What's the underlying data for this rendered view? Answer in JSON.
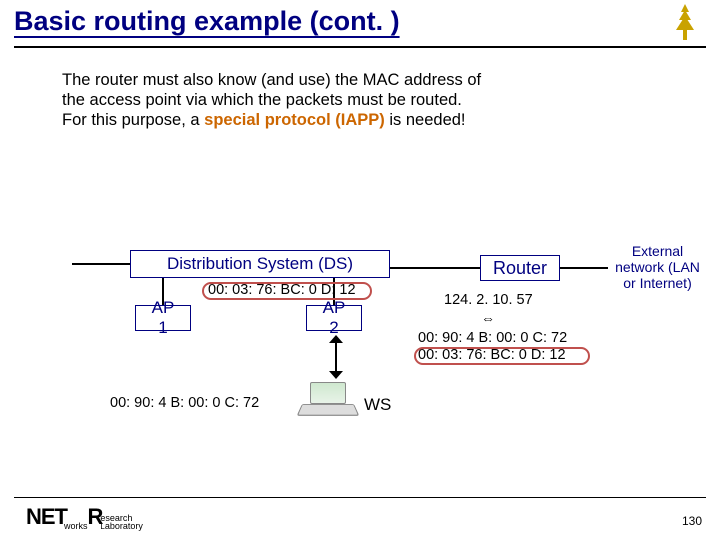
{
  "title": "Basic routing example (cont. )",
  "body": {
    "line1": "The router must also know (and use) the MAC address of",
    "line2": "the access point via which the packets must be routed.",
    "line3_prefix": "For this purpose, a ",
    "line3_special": "special protocol (IAPP)",
    "line3_suffix": " is needed!"
  },
  "diagram": {
    "ds": "Distribution System (DS)",
    "router": "Router",
    "external_network": "External network (LAN or Internet)",
    "ap1": "AP 1",
    "ap2": "AP 2",
    "mac_ap2": "00: 03: 76: BC: 0 D: 12",
    "ip_router": "124. 2. 10. 57",
    "arrow_both": "⇔",
    "mac_ws": "00: 90: 4 B: 00: 0 C: 72",
    "mac_ap2_rt": "00: 03: 76: BC: 0 D: 12",
    "mac_ws_left": "00: 90: 4 B: 00: 0 C: 72",
    "ws": "WS"
  },
  "footer": {
    "logo_net": "NET",
    "logo_r": "R",
    "logo_small_top": "works",
    "logo_small_mid": "esearch",
    "logo_small_bot": "aboratory"
  },
  "page_number": "130"
}
